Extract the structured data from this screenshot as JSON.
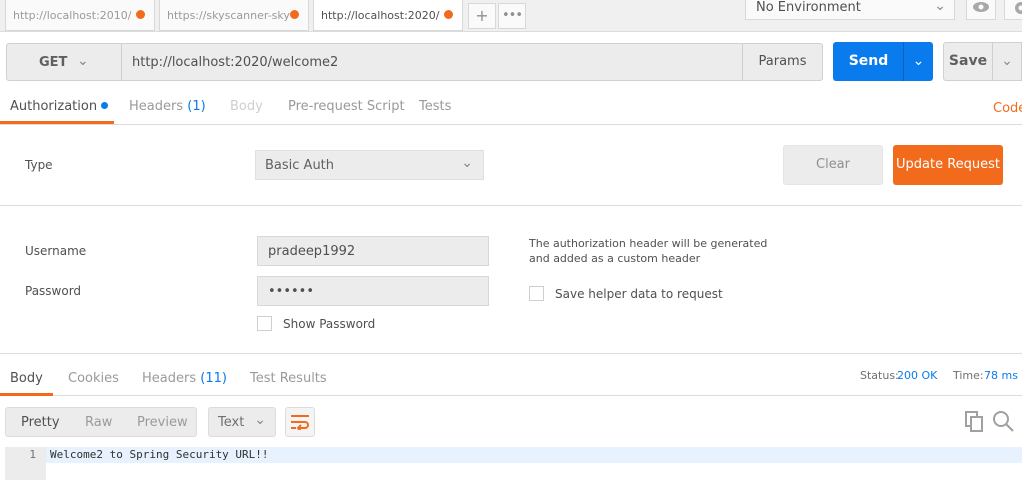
{
  "tabs": [
    {
      "url": "http://localhost:2010/"
    },
    {
      "url": "https://skyscanner-sky"
    },
    {
      "url": "http://localhost:2020/"
    }
  ],
  "environment": {
    "selected": "No Environment"
  },
  "request": {
    "method": "GET",
    "url": "http://localhost:2020/welcome2",
    "params_label": "Params",
    "send_label": "Send",
    "save_label": "Save"
  },
  "request_tabs": {
    "authorization": "Authorization",
    "headers": "Headers",
    "headers_count": "(1)",
    "body": "Body",
    "prerequest": "Pre-request Script",
    "tests": "Tests",
    "code": "Code"
  },
  "auth": {
    "type_label": "Type",
    "type_value": "Basic Auth",
    "clear_label": "Clear",
    "update_label": "Update Request",
    "username_label": "Username",
    "username_value": "pradeep1992",
    "password_label": "Password",
    "password_value": "••••••",
    "show_password_label": "Show Password",
    "info_text": "The authorization header will be generated and added as a custom header",
    "save_helper_label": "Save helper data to request"
  },
  "response_tabs": {
    "body": "Body",
    "cookies": "Cookies",
    "headers": "Headers",
    "headers_count": "(11)",
    "test_results": "Test Results",
    "status_label": "Status:",
    "status_value": "200 OK",
    "time_label": "Time:",
    "time_value": "78 ms"
  },
  "body_toolbar": {
    "pretty": "Pretty",
    "raw": "Raw",
    "preview": "Preview",
    "format": "Text"
  },
  "response_body": {
    "line_number": "1",
    "line_text": "Welcome2 to Spring Security URL!!"
  },
  "colors": {
    "accent_orange": "#f26b1d",
    "accent_blue": "#097bed"
  }
}
